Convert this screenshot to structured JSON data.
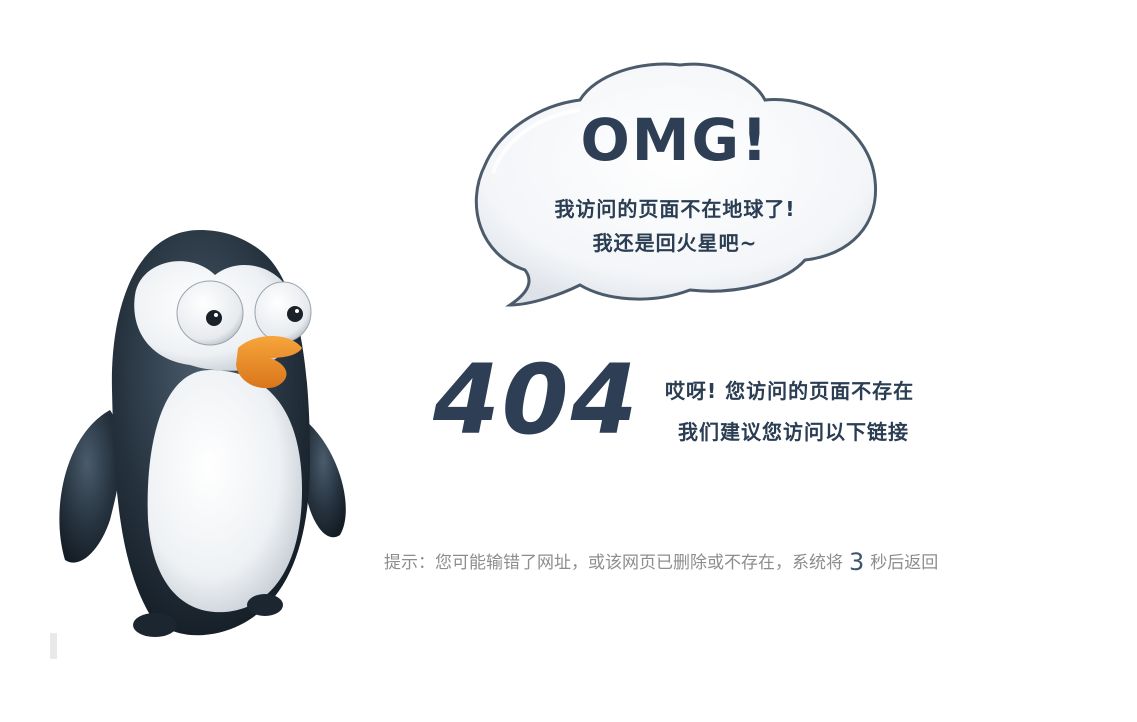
{
  "bubble": {
    "title": "OMG!",
    "line1": "我访问的页面不在地球了!",
    "line2": "我还是回火星吧~"
  },
  "error": {
    "code": "404",
    "message_line1": "哎呀! 您访问的页面不存在",
    "message_line2": "我们建议您访问以下链接"
  },
  "hint": {
    "prefix": "提示：您可能输错了网址，或该网页已删除或不存在，系统将",
    "countdown": "3",
    "suffix": "秒后返回"
  },
  "colors": {
    "text_dark": "#2b3d52",
    "hint_gray": "#8d8d8d",
    "penguin_body": "#26333f"
  }
}
